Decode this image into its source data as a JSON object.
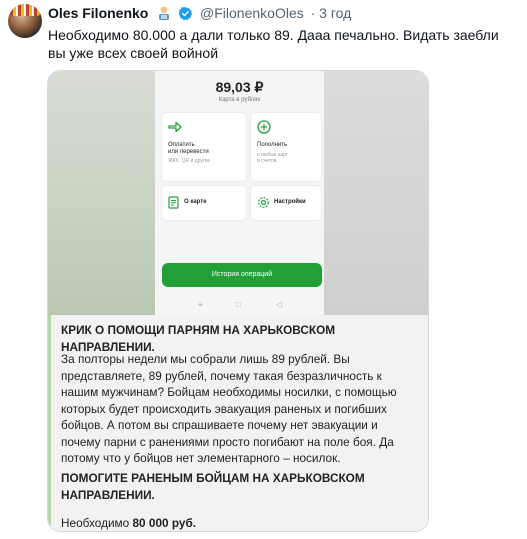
{
  "tweet": {
    "author_name": "Oles Filonenko",
    "handle": "@FilonenkoOles",
    "time": "· 3 год",
    "text": "Необходимо 80.000 а дали только 89. Дааа печально. Видать заебли вы уже всех своей войной",
    "icons": {
      "avatar": "avatar",
      "emoji": "person-emoji-icon",
      "verified": "verified-badge-icon"
    }
  },
  "phone": {
    "balance": "89,03 ₽",
    "balance_sub": "Карта в рублях",
    "tiles": {
      "pay_title": "Оплатить\nили перевести",
      "pay_sub": "ЖКХ, QR и другое",
      "topup_title": "Пополнить",
      "topup_sub": "с любых карт\nи счетов",
      "card_title": "О карте",
      "settings_title": "Настройки"
    },
    "history_button": "История операций",
    "accent": "#21a038"
  },
  "post": {
    "heading": "КРИК О ПОМОЩИ ПАРНЯМ НА ХАРЬКОВСКОМ НАПРАВЛЕНИИ.",
    "body": "За полторы недели мы собрали лишь 89 рублей. Вы представляете, 89 рублей, почему такая безразличность к нашим мужчинам? Бойцам необходимы носилки, с помощью которых будет происходить эвакуация раненых и погибших бойцов. А потом вы спрашиваете почему нет эвакуации и почему парни с ранениями просто погибают на поле боя. Да потому что у бойцов нет элементарного – носилок.",
    "call": "ПОМОГИТЕ РАНЕНЫМ БОЙЦАМ НА ХАРЬКОВСКОМ НАПРАВЛЕНИИ.",
    "need_label": "Необходимо ",
    "need_value": "80 000 руб."
  }
}
